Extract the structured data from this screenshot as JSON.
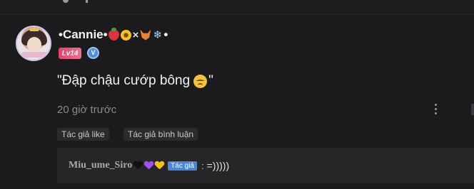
{
  "comment": {
    "username": "•Cannie•",
    "username_suffix": "•",
    "name_emojis": [
      "strawberry",
      "sunflower",
      "fox",
      "snowflake"
    ],
    "cross": "×",
    "level_badge": "Lv14",
    "verified_badge_icon": "v-badge",
    "text_open": "\"Đập chậu cướp bông",
    "text_close": "\"",
    "text_emoji": "pensive-face",
    "timestamp": "20 giờ trước",
    "author_like_chip": "Tác giả like",
    "author_reply_chip": "Tác giả bình luận"
  },
  "reply": {
    "author": "Miu_ume_Siro",
    "hearts": [
      "#111111",
      "#a24ef0",
      "#f2c215"
    ],
    "author_tag": "Tác giả",
    "colon": ":",
    "text": "=)))))"
  },
  "colors": {
    "background": "#1b1b1d",
    "level_badge": "#e4426a",
    "author_tag": "#4a86d8"
  }
}
